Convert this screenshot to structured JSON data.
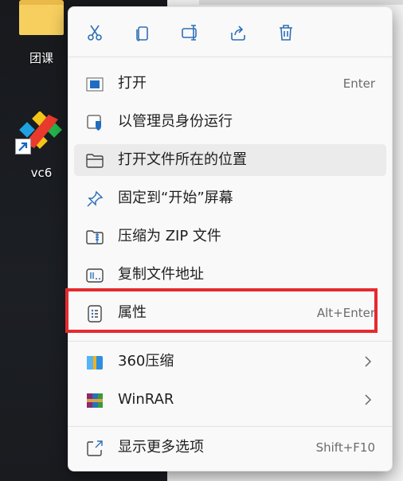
{
  "desktop": {
    "icons": [
      {
        "label": "团课",
        "icon": "folder-icon"
      },
      {
        "label": "vc6",
        "icon": "vc6-app-icon"
      }
    ]
  },
  "menu": {
    "toolbar": [
      {
        "name": "cut",
        "icon": "scissors-icon"
      },
      {
        "name": "copy",
        "icon": "copy-icon"
      },
      {
        "name": "rename",
        "icon": "rename-icon"
      },
      {
        "name": "share",
        "icon": "share-icon"
      },
      {
        "name": "delete",
        "icon": "trash-icon"
      }
    ],
    "items": [
      {
        "label": "打开",
        "shortcut": "Enter",
        "icon": "open-window-icon"
      },
      {
        "label": "以管理员身份运行",
        "shortcut": "",
        "icon": "shield-icon"
      },
      {
        "label": "打开文件所在的位置",
        "shortcut": "",
        "icon": "folder-icon"
      },
      {
        "label": "固定到“开始”屏幕",
        "shortcut": "",
        "icon": "pin-icon"
      },
      {
        "label": "压缩为 ZIP 文件",
        "shortcut": "",
        "icon": "zip-folder-icon"
      },
      {
        "label": "复制文件地址",
        "shortcut": "",
        "icon": "copy-path-icon"
      },
      {
        "label": "属性",
        "shortcut": "Alt+Enter",
        "icon": "properties-icon"
      },
      {
        "label": "360压缩",
        "shortcut": "",
        "icon": "360-compress-icon",
        "submenu": true
      },
      {
        "label": "WinRAR",
        "shortcut": "",
        "icon": "winrar-icon",
        "submenu": true
      },
      {
        "label": "显示更多选项",
        "shortcut": "Shift+F10",
        "icon": "more-options-icon"
      }
    ]
  },
  "colors": {
    "menu_bg": "#f9f9f9",
    "hover_bg": "#ebebeb",
    "accent_blue": "#0f6cbd",
    "highlight_red": "#e52a2f"
  }
}
